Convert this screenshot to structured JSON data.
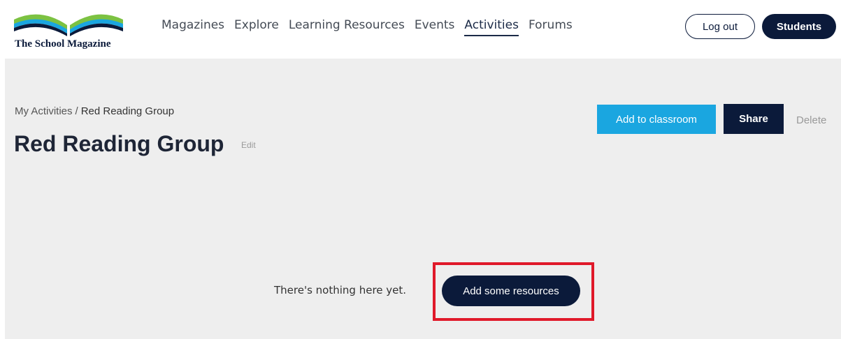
{
  "header": {
    "logo_text": "The School Magazine",
    "nav": [
      {
        "label": "Magazines",
        "active": false
      },
      {
        "label": "Explore",
        "active": false
      },
      {
        "label": "Learning Resources",
        "active": false
      },
      {
        "label": "Events",
        "active": false
      },
      {
        "label": "Activities",
        "active": true
      },
      {
        "label": "Forums",
        "active": false
      }
    ],
    "logout_label": "Log out",
    "students_label": "Students"
  },
  "breadcrumb": {
    "parent": "My Activities",
    "separator": "/",
    "current": "Red Reading Group"
  },
  "page": {
    "title": "Red Reading Group",
    "edit_label": "Edit"
  },
  "actions": {
    "add_to_classroom": "Add to classroom",
    "share": "Share",
    "delete": "Delete"
  },
  "empty_state": {
    "message": "There's nothing here yet.",
    "add_button": "Add some resources"
  },
  "colors": {
    "brand_navy": "#0b1a3a",
    "accent_blue": "#1aa6e0",
    "highlight_red": "#e0192a",
    "panel_bg": "#eeeeee"
  },
  "icons": {
    "logo": "open-book-logo-icon"
  }
}
